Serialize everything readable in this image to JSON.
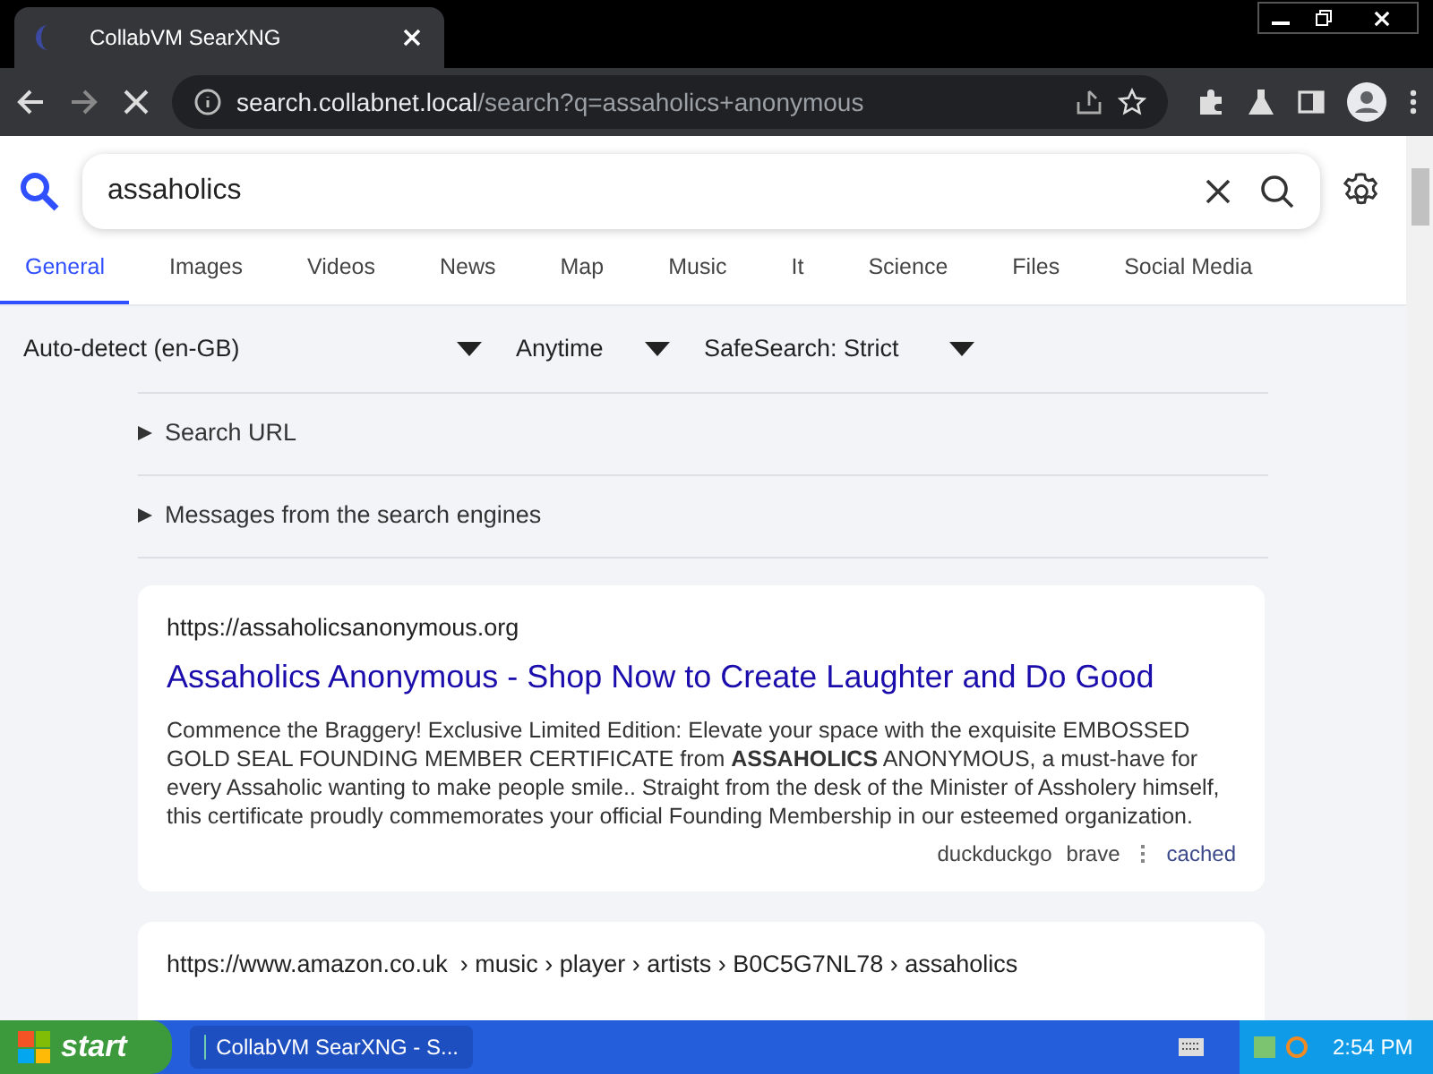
{
  "browser": {
    "tab_title": "CollabVM SearXNG",
    "url_host": "search.collabnet.local",
    "url_path": "/search?q=assaholics+anonymous"
  },
  "search": {
    "query": "assaholics"
  },
  "categories": [
    {
      "label": "General",
      "selected": true
    },
    {
      "label": "Images",
      "selected": false
    },
    {
      "label": "Videos",
      "selected": false
    },
    {
      "label": "News",
      "selected": false
    },
    {
      "label": "Map",
      "selected": false
    },
    {
      "label": "Music",
      "selected": false
    },
    {
      "label": "It",
      "selected": false
    },
    {
      "label": "Science",
      "selected": false
    },
    {
      "label": "Files",
      "selected": false
    },
    {
      "label": "Social Media",
      "selected": false
    }
  ],
  "filters": [
    {
      "label": "Auto-detect (en-GB)"
    },
    {
      "label": "Anytime"
    },
    {
      "label": "SafeSearch: Strict"
    }
  ],
  "details": [
    {
      "label": "Search URL",
      "expanded": false
    },
    {
      "label": "Messages from the search engines",
      "expanded": false
    }
  ],
  "results": [
    {
      "url": "https://assaholicsanonymous.org",
      "title": "Assaholics Anonymous - Shop Now to Create Laughter and Do Good",
      "snippet": "Commence the Braggery! Exclusive Limited Edition: Elevate your space with the exquisite EMBOSSED GOLD SEAL FOUNDING MEMBER CERTIFICATE from **ASSAHOLICS** ANONYMOUS, a must-have for every Assaholic wanting to make people smile.. Straight from the desk of the Minister of Assholery himself, this certificate proudly commemorates your official Founding Membership in our esteemed organization.",
      "engines": [
        "duckduckgo",
        "brave"
      ],
      "cached": "cached"
    },
    {
      "url": "https://www.amazon.co.uk",
      "path": "› music › player › artists › B0C5G7NL78 › assaholics"
    }
  ],
  "taskbar": {
    "start": "start",
    "window": "CollabVM SearXNG - S...",
    "clock": "2:54 PM"
  }
}
